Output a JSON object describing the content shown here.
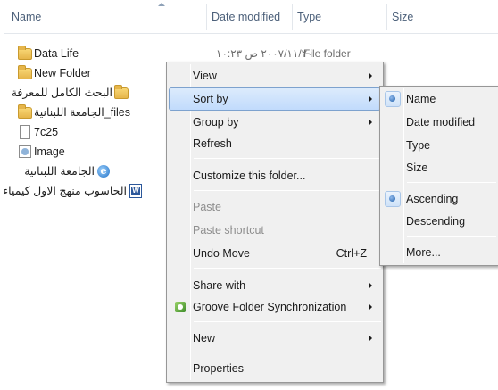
{
  "columns": {
    "name": "Name",
    "date_modified": "Date modified",
    "type": "Type",
    "size": "Size"
  },
  "files": [
    {
      "name": "Data Life",
      "icon": "folder-icon",
      "date": "٢٠٠٧/١١/٢٠ ص ١٠:٢٣",
      "type": "File folder"
    },
    {
      "name": "New Folder",
      "icon": "folder-icon",
      "date": "",
      "type": ""
    },
    {
      "name": "البحث الكامل للمعرفة",
      "icon": "folder-icon",
      "date": "",
      "type": ""
    },
    {
      "name": "الجامعة اللبنانية_files",
      "icon": "folder-icon",
      "date": "",
      "type": ""
    },
    {
      "name": "7c25",
      "icon": "file-icon",
      "date": "",
      "type": ""
    },
    {
      "name": "Image",
      "icon": "image-icon",
      "date": "",
      "type": ""
    },
    {
      "name": "الجامعة اللبنانية",
      "icon": "ie-html-icon",
      "date": "",
      "type": ""
    },
    {
      "name": "الحاسوب منهج الاول كيمياء",
      "icon": "word-doc-icon",
      "date": "",
      "type": ""
    }
  ],
  "context_menu": {
    "view": "View",
    "sort_by": "Sort by",
    "group_by": "Group by",
    "refresh": "Refresh",
    "customize": "Customize this folder...",
    "paste": "Paste",
    "paste_shortcut": "Paste shortcut",
    "undo_move": "Undo Move",
    "undo_shortcut": "Ctrl+Z",
    "share_with": "Share with",
    "groove": "Groove Folder Synchronization",
    "new": "New",
    "properties": "Properties"
  },
  "sort_submenu": {
    "name": "Name",
    "date_modified": "Date modified",
    "type": "Type",
    "size": "Size",
    "ascending": "Ascending",
    "descending": "Descending",
    "more": "More...",
    "selected_field": "Name",
    "selected_order": "Ascending"
  },
  "colors": {
    "menu_bg": "#f0f0f0",
    "highlight": "#c1dbfc",
    "header_text": "#4c607a"
  }
}
